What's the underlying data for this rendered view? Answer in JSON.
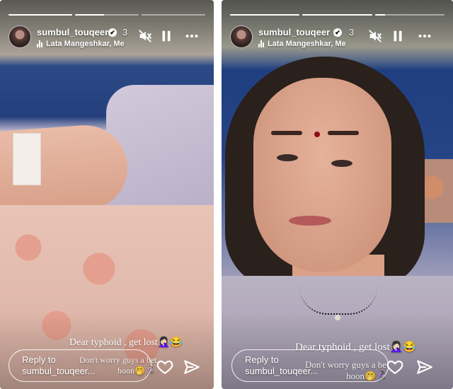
{
  "stories": [
    {
      "username": "sumbul_touqeer",
      "verified_glyph": "✔",
      "age": "3",
      "music": "Lata Mangeshkar, Me",
      "progress": [
        1.0,
        0.45,
        0.0
      ],
      "caption_line1": "Dear typhoid , get lost🤦🏻‍♀️😂",
      "caption_line2": "Don't worry guys a bet",
      "caption_line3": "hoon🤭🏃🏻‍♀️",
      "reply_line1": "Reply to",
      "reply_line2": "sumbul_touqeer...",
      "icons": [
        "mute-icon",
        "pause-icon",
        "more-icon",
        "heart-icon",
        "send-icon"
      ]
    },
    {
      "username": "sumbul_touqeer",
      "verified_glyph": "✔",
      "age": "3",
      "music": "Lata Mangeshkar, Me",
      "progress": [
        1.0,
        1.0,
        0.15
      ],
      "caption_line1": "Dear typhoid , get lost🤦🏻‍♀️😂",
      "caption_line2": "Don't worry guys a bet",
      "caption_line3": "hoon🤭🏃🏻‍♀️",
      "reply_line1": "Reply to",
      "reply_line2": "sumbul_touqeer...",
      "icons": [
        "mute-icon",
        "pause-icon",
        "more-icon",
        "heart-icon",
        "send-icon"
      ]
    }
  ]
}
